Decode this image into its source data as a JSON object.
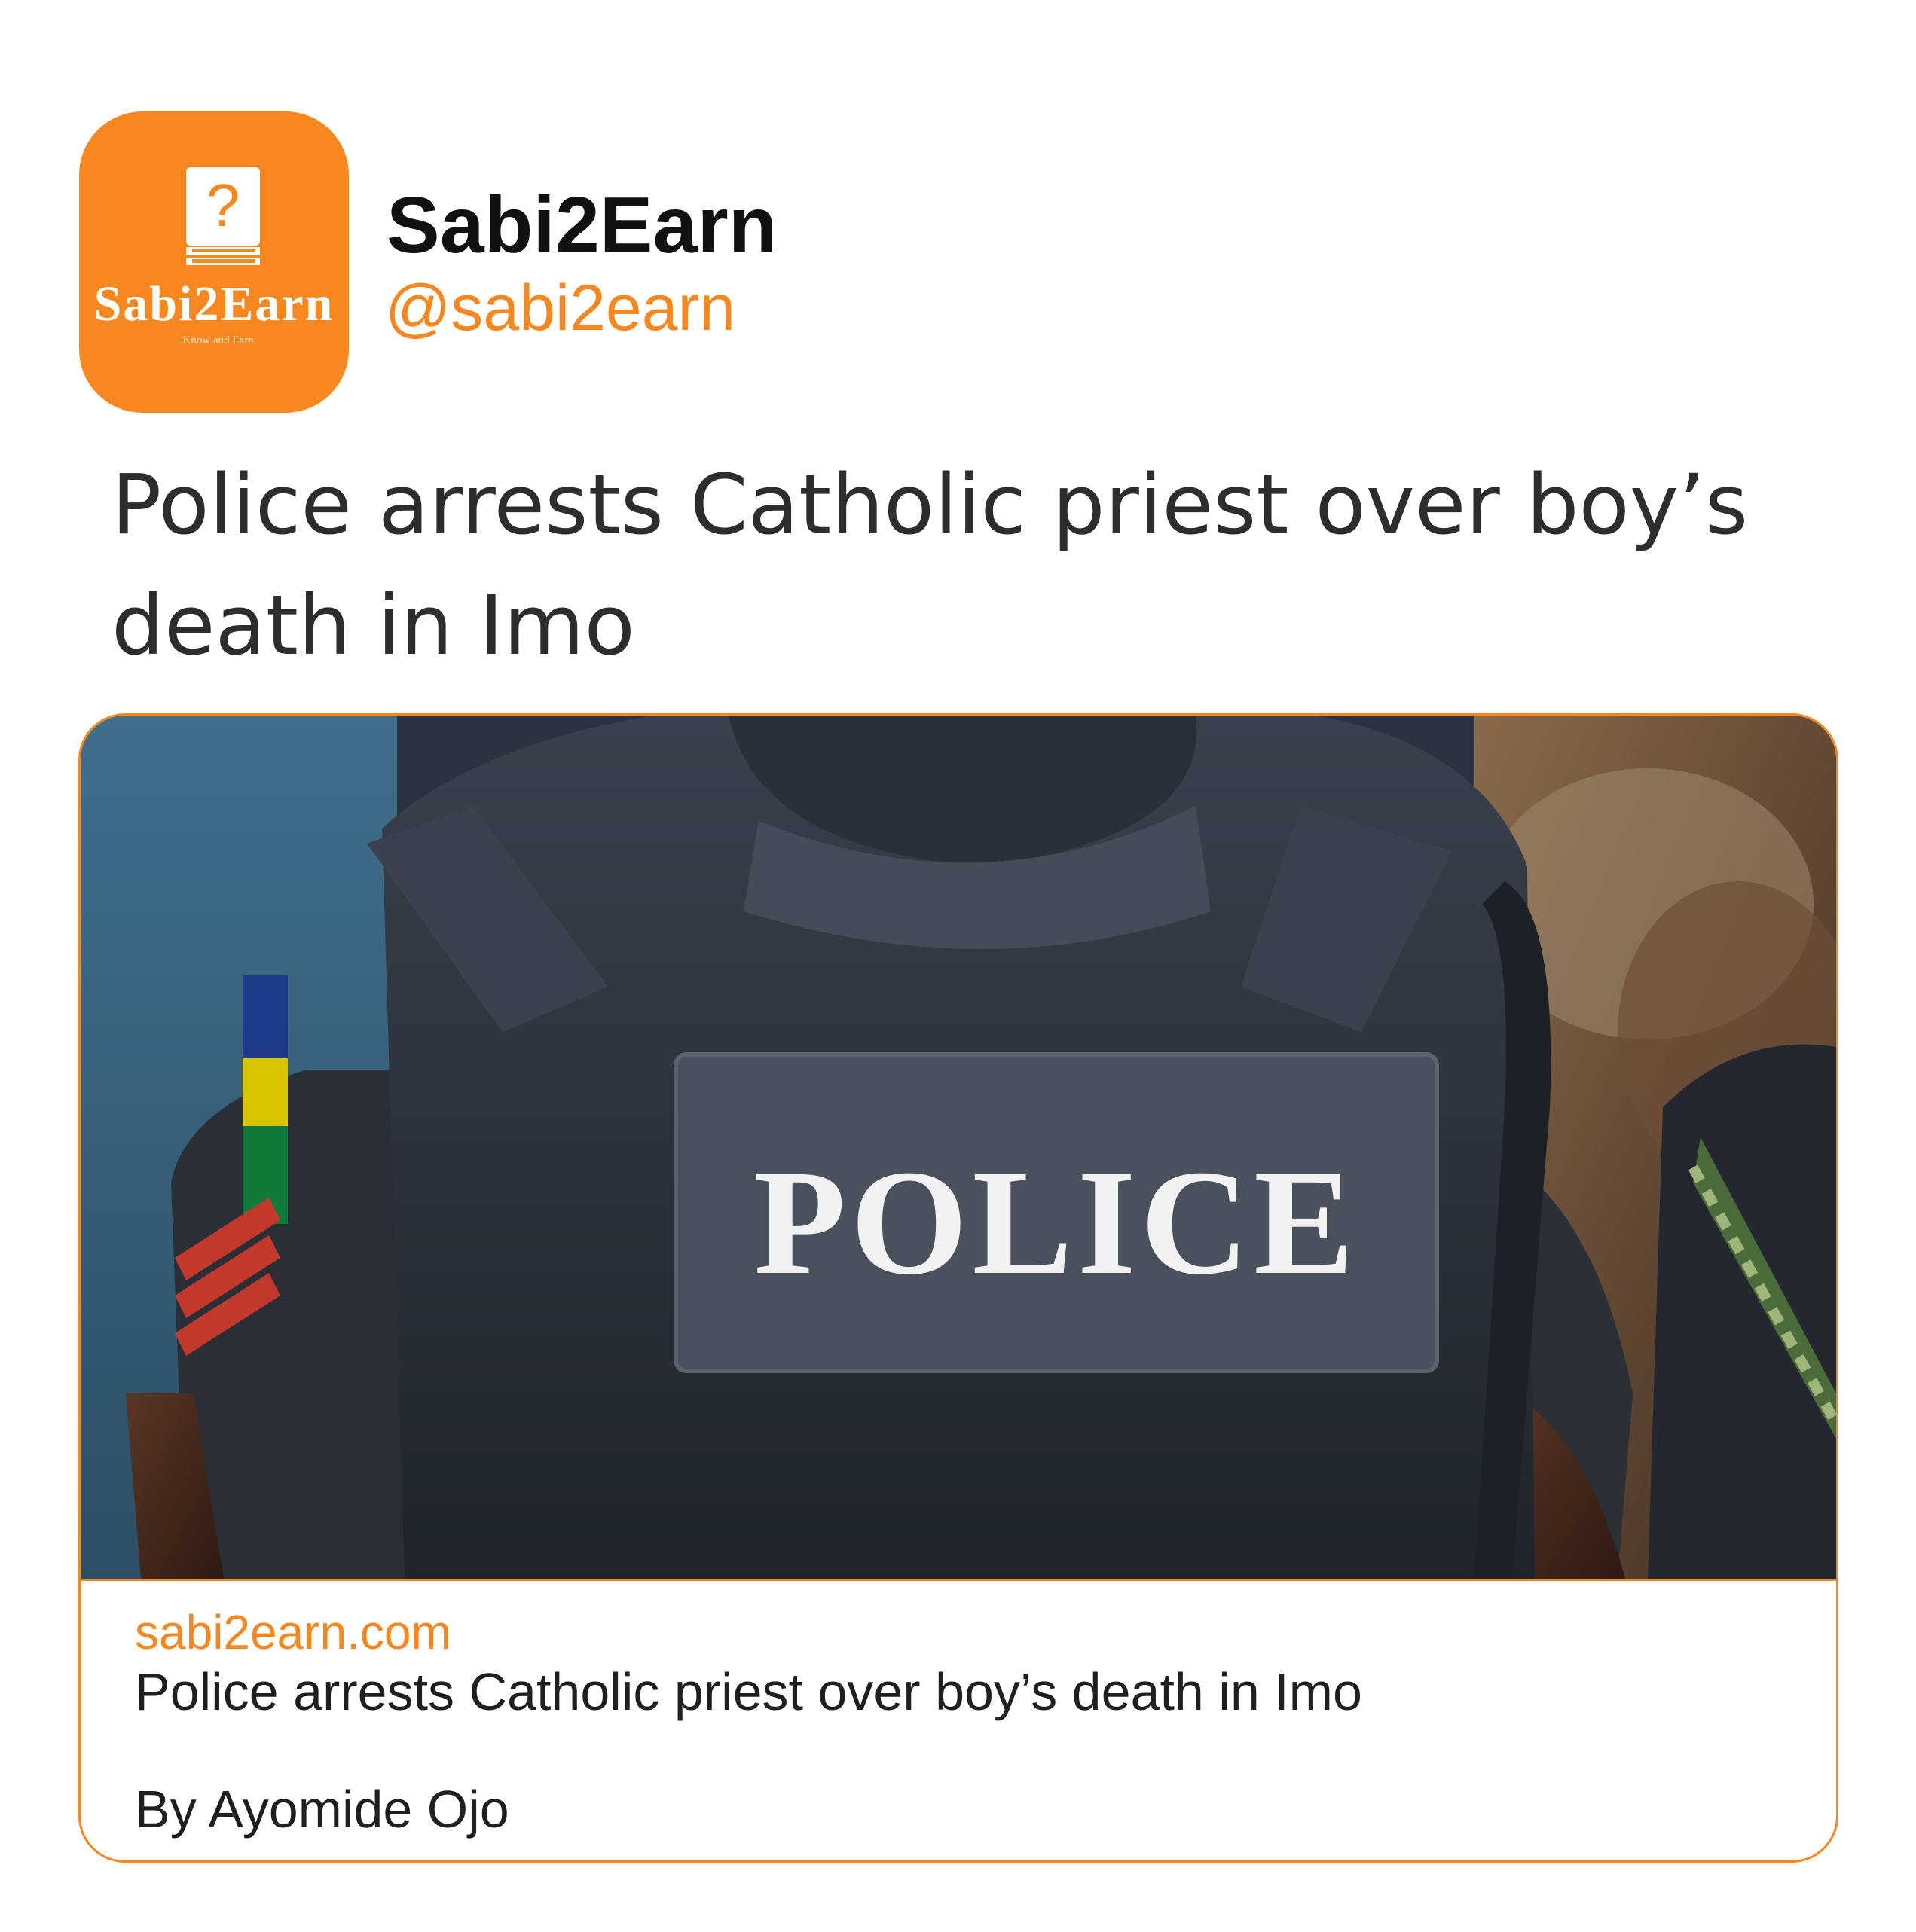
{
  "account": {
    "display_name": "Sabi2Earn",
    "handle": "@sabi2earn",
    "avatar_logo_text": "Sabi2Earn",
    "avatar_logo_tagline": "...Know and Earn",
    "avatar_color": "#f7871e"
  },
  "tweet": {
    "text": "Police arrests Catholic priest over boy’s death in Imo"
  },
  "card": {
    "image_label": "POLICE",
    "domain": "sabi2earn.com",
    "title": "Police arrests Catholic priest over boy’s death in Imo",
    "byline": "By Ayomide Ojo",
    "border_color": "#f7871e"
  }
}
